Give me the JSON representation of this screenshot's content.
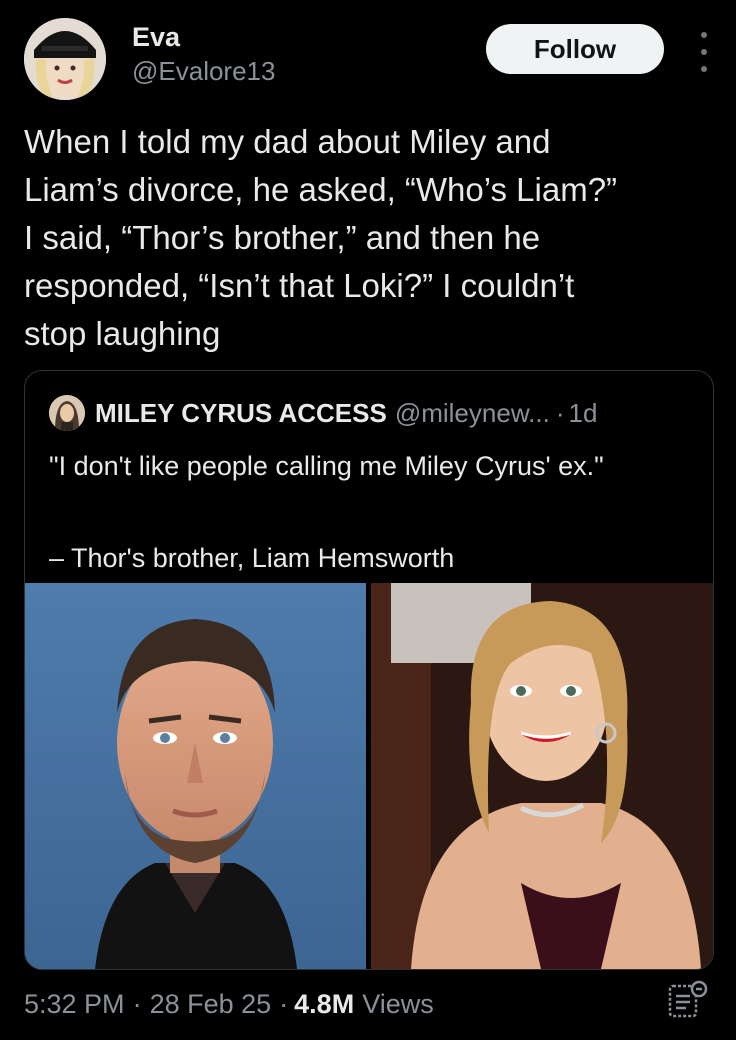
{
  "author": {
    "display_name": "Eva",
    "handle": "@Evalore13"
  },
  "header": {
    "follow_label": "Follow",
    "more_icon": "more-vertical-icon"
  },
  "tweet": {
    "text": "When I told my dad about Miley and\nLiam’s divorce, he asked, “Who’s Liam?”\nI said, “Thor’s brother,” and then he\nresponded, “Isn’t that Loki?” I couldn’t\nstop laughing"
  },
  "quote": {
    "name": "MILEY CYRUS ACCESS",
    "handle": "@mileynew...",
    "separator": "·",
    "time": "1d",
    "text": "\"I don't like people calling me Miley Cyrus' ex.\"\n\n– Thor's brother, Liam Hemsworth"
  },
  "footer": {
    "time": "5:32 PM",
    "separator": "·",
    "date": "28 Feb 25",
    "views_count": "4.8M",
    "views_label": "Views",
    "analytics_icon": "view-analytics-icon"
  },
  "colors": {
    "background": "#000000",
    "text_primary": "#e7e9ea",
    "text_secondary": "#8b9198",
    "border": "#2f3336",
    "button_bg": "#eff3f4"
  }
}
